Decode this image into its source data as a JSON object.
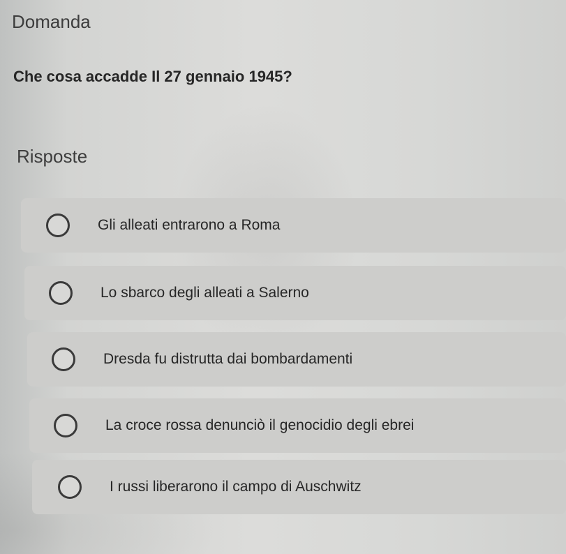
{
  "header": {
    "section_label": "Domanda",
    "question": "Che cosa accadde Il 27 gennaio 1945?"
  },
  "answers_section": {
    "label": "Risposte",
    "options": [
      {
        "label": "Gli alleati entrarono a Roma",
        "selected": false
      },
      {
        "label": "Lo sbarco degli alleati a Salerno",
        "selected": false
      },
      {
        "label": "Dresda fu distrutta dai bombardamenti",
        "selected": false
      },
      {
        "label": "La croce rossa denunciò il genocidio degli ebrei",
        "selected": false
      },
      {
        "label": "I russi liberarono il campo di Auschwitz",
        "selected": false
      }
    ]
  },
  "colors": {
    "background": "#d7d8d6",
    "card": "#cdcdcb",
    "text": "#262626",
    "radio_border": "#3a3a3a"
  }
}
